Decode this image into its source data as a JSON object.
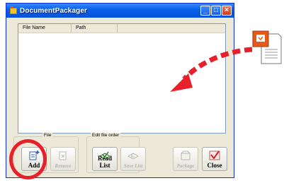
{
  "window": {
    "title": "DocumentPackager"
  },
  "list": {
    "headers": [
      "File Name",
      "Path"
    ]
  },
  "groups": {
    "add_file_partial": "File",
    "edit_file_order": "Edit file order"
  },
  "buttons": {
    "add": "Add",
    "remove": "Remove",
    "read_list": "Read List",
    "save_list": "Save List",
    "package": "Package",
    "close": "Close"
  },
  "colors": {
    "highlight": "#e8202a",
    "arrow": "#e8202a",
    "title_bar": "#0a5fe8"
  },
  "icons": {
    "app": "app-icon",
    "file": "presentation-file-icon",
    "arrow": "curved-dashed-arrow-icon"
  }
}
